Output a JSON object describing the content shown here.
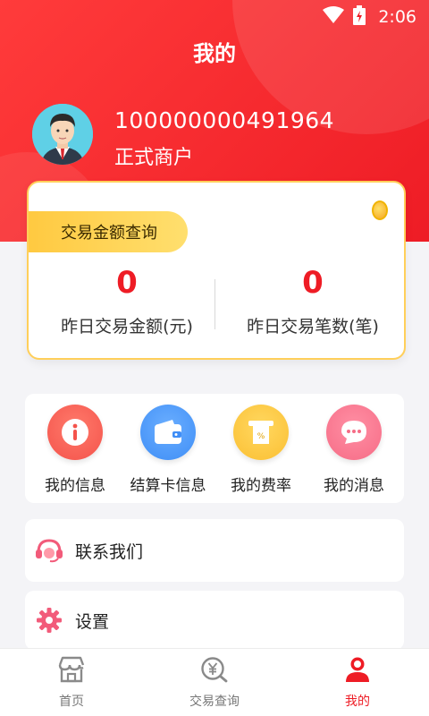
{
  "status_bar": {
    "time": "2:06",
    "icons": [
      "wifi-icon",
      "battery-icon"
    ]
  },
  "header": {
    "title": "我的"
  },
  "profile": {
    "user_id": "100000000491964",
    "role": "正式商户"
  },
  "stats_card": {
    "tag": "交易金额查询",
    "left": {
      "value": "0",
      "label": "昨日交易金额(元)"
    },
    "right": {
      "value": "0",
      "label": "昨日交易笔数(笔)"
    }
  },
  "quick_menu": [
    {
      "label": "我的信息",
      "icon": "info-icon",
      "color": "#f4534b"
    },
    {
      "label": "结算卡信息",
      "icon": "wallet-icon",
      "color": "#3f8ef6"
    },
    {
      "label": "我的费率",
      "icon": "rate-receipt-icon",
      "color": "#fbbf33"
    },
    {
      "label": "我的消息",
      "icon": "message-icon",
      "color": "#f66c86"
    }
  ],
  "list": [
    {
      "label": "联系我们",
      "icon": "headset-icon"
    },
    {
      "label": "设置",
      "icon": "gear-icon"
    }
  ],
  "tab_bar": [
    {
      "label": "首页",
      "icon": "store-icon",
      "active": false
    },
    {
      "label": "交易查询",
      "icon": "yen-search-icon",
      "active": false
    },
    {
      "label": "我的",
      "icon": "user-icon",
      "active": true
    }
  ],
  "colors": {
    "brand_red": "#ee1c25",
    "gold": "#ffc940",
    "background": "#f4f4f7"
  }
}
